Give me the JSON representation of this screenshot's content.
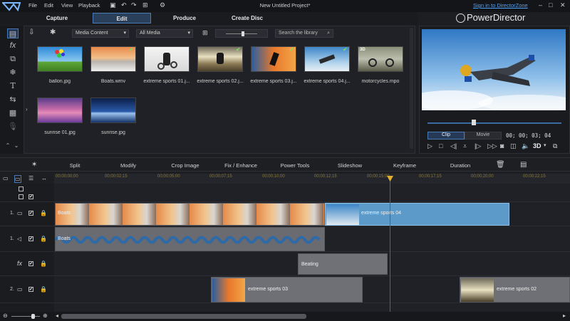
{
  "window": {
    "title": "New Untitled Project*",
    "menu": [
      "File",
      "Edit",
      "View",
      "Playback"
    ],
    "signin": "Sign in to DirectorZone",
    "brand": "PowerDirector"
  },
  "tabs": [
    {
      "label": "Capture"
    },
    {
      "label": "Edit"
    },
    {
      "label": "Produce"
    },
    {
      "label": "Create Disc"
    }
  ],
  "library": {
    "filter1": "Media Content",
    "filter2": "All Media",
    "search_placeholder": "Search the library",
    "items": [
      {
        "label": "ballon.jpg",
        "checked": false
      },
      {
        "label": "Boats.wmv",
        "checked": true
      },
      {
        "label": "extreme sports 01.j...",
        "checked": false
      },
      {
        "label": "extreme sports 02.j...",
        "checked": true
      },
      {
        "label": "extreme sports 03.j...",
        "checked": true
      },
      {
        "label": "extreme sports 04.j...",
        "checked": true
      },
      {
        "label": "motorcycles.mpo",
        "checked": false,
        "badge": "3D"
      },
      {
        "label": "sunrise 01.jpg",
        "checked": false
      },
      {
        "label": "sunrise.jpg",
        "checked": false
      }
    ]
  },
  "preview": {
    "mode_clip": "Clip",
    "mode_movie": "Movie",
    "timecode": "00; 00; 03; 04",
    "threed": "3D"
  },
  "editbar": {
    "split": "Split",
    "modify": "Modify",
    "crop": "Crop Image",
    "fix": "Fix / Enhance",
    "power": "Power Tools",
    "slideshow": "Slideshow",
    "keyframe": "Keyframe",
    "duration": "Duration"
  },
  "ruler": [
    "00;00;00;00",
    "00;00;02;15",
    "00;00;05;00",
    "00;00;07;15",
    "00;00;10;00",
    "00;00;12;15",
    "00;00;15;00",
    "00;00;17;15",
    "00;00;20;00",
    "00;00;22;15"
  ],
  "tracks": {
    "video1_label": "1.",
    "audio1_label": "1.",
    "fx_label": "fx",
    "video2_label": "2.",
    "clip_boats_video": "Boats",
    "clip_boats_audio": "Boats",
    "clip_es04": "extreme sports 04",
    "clip_beating": "Beating",
    "clip_es03": "extreme sports 03",
    "clip_es02": "extreme sports 02"
  },
  "colors": {
    "accent": "#4a7ab5",
    "playhead": "#d03030",
    "clip_selected": "#5b9ac9"
  }
}
